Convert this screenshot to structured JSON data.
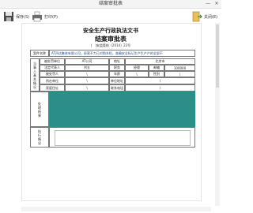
{
  "window": {
    "title": "结案审批表",
    "min": "—",
    "close": "✕"
  },
  "toolbar": {
    "save_label": "保存(S)",
    "print_label": "打印(P)",
    "exit_label": "关闭(E)"
  },
  "doc": {
    "title": "安全生产行政执法文书",
    "subtitle": "结案审批表",
    "doc_no": "(　)安监管结〔2014〕22号",
    "case_name_label": "案件名称",
    "case_name_value": "AT四达集体有限公司，经营不力已对照本机，准确安全标记生产生产产的全部不",
    "party_section_label": "当事人基本情况",
    "rows": [
      [
        "被处罚单位",
        "AT公司",
        "地址",
        "北京市"
      ],
      [
        "法定代表人",
        "刘五",
        "职务",
        "经理",
        "邮编",
        "100000"
      ],
      [
        "被处罚人",
        "\\",
        "年龄",
        "\\",
        "性别",
        "\\"
      ],
      [
        "所在单位",
        "\\",
        "单位地址",
        "\\"
      ],
      [
        "家庭住址",
        "\\",
        "联系电话",
        "\\"
      ]
    ],
    "handle_label": "处理结果",
    "exec_label": "执行情况"
  }
}
